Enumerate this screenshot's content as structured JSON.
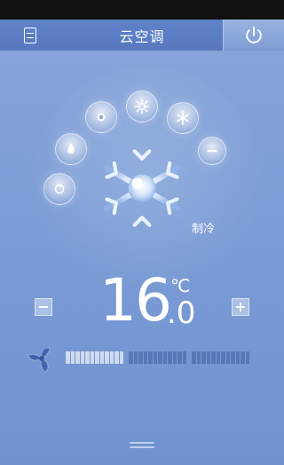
{
  "header": {
    "title": "云空调"
  },
  "mode": {
    "label": "制冷"
  },
  "temperature": {
    "integer": "16",
    "decimal": ".0",
    "unit": "℃"
  },
  "controls": {
    "minus": "−",
    "plus": "+"
  },
  "fan_speed": {
    "level_fraction": 0.32
  },
  "icons": {
    "menu": "menu-list-icon",
    "power": "power-icon",
    "modes": [
      "swing-icon",
      "dry-mode-icon",
      "auto-mode-icon",
      "heat-mode-icon",
      "snow-mode-icon",
      "minus-icon"
    ],
    "current_mode": "snowflake-icon",
    "fan": "fan-icon"
  },
  "colors": {
    "accent": "#5778bf",
    "background": "#7f9fd7"
  }
}
